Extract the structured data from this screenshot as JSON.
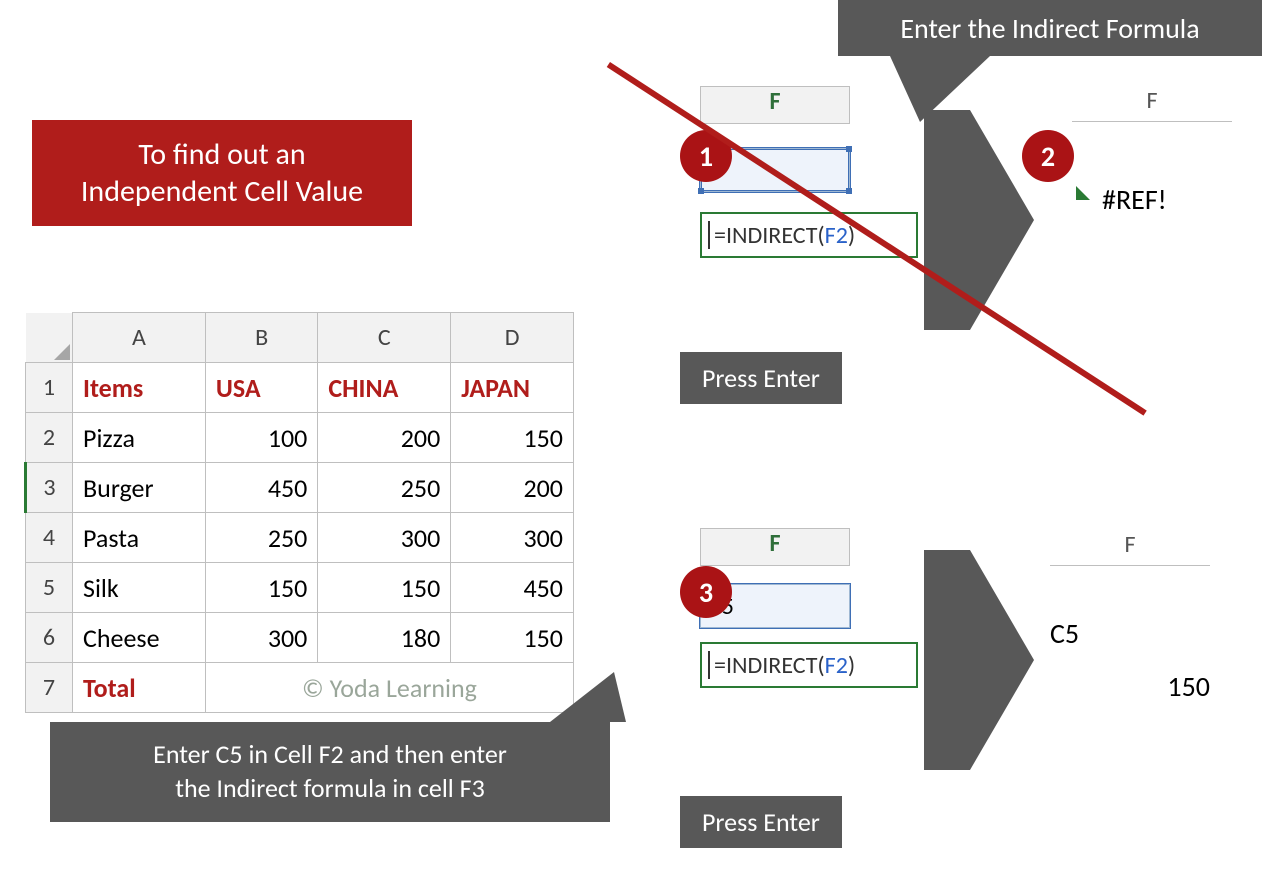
{
  "callouts": {
    "top": "Enter the Indirect Formula",
    "red_line1": "To find out an",
    "red_line2": "Independent Cell Value",
    "bottom_line1": "Enter C5 in Cell F2 and then enter",
    "bottom_line2": "the Indirect formula in cell F3",
    "press_enter": "Press Enter"
  },
  "badges": {
    "one": "1",
    "two": "2",
    "three": "3"
  },
  "sheet": {
    "colA": "A",
    "colB": "B",
    "colC": "C",
    "colD": "D",
    "r1": "1",
    "r2": "2",
    "r3": "3",
    "r4": "4",
    "r5": "5",
    "r6": "6",
    "r7": "7",
    "h_items": "Items",
    "h_usa": "USA",
    "h_china": "CHINA",
    "h_japan": "JAPAN",
    "rows": {
      "pizza": {
        "name": "Pizza",
        "usa": "100",
        "china": "200",
        "japan": "150"
      },
      "burger": {
        "name": "Burger",
        "usa": "450",
        "china": "250",
        "japan": "200"
      },
      "pasta": {
        "name": "Pasta",
        "usa": "250",
        "china": "300",
        "japan": "300"
      },
      "silk": {
        "name": "Silk",
        "usa": "150",
        "china": "150",
        "japan": "450"
      },
      "cheese": {
        "name": "Cheese",
        "usa": "300",
        "china": "180",
        "japan": "150"
      }
    },
    "total_label": "Total",
    "watermark": "© Yoda Learning"
  },
  "frag": {
    "col_letter": "F",
    "formula_eq": "=INDIRECT(",
    "formula_arg": "F2",
    "formula_close": ")",
    "c5_label": "C5",
    "ref_error": "#REF!",
    "result_value": "150"
  },
  "chart_data": {
    "type": "table",
    "title": "To find out an Independent Cell Value",
    "columns": [
      "Items",
      "USA",
      "CHINA",
      "JAPAN"
    ],
    "rows": [
      [
        "Pizza",
        100,
        200,
        150
      ],
      [
        "Burger",
        450,
        250,
        200
      ],
      [
        "Pasta",
        250,
        300,
        300
      ],
      [
        "Silk",
        150,
        150,
        450
      ],
      [
        "Cheese",
        300,
        180,
        150
      ]
    ],
    "annotations": [
      "Enter the Indirect Formula",
      "Press Enter",
      "Enter C5 in Cell F2 and then enter the Indirect formula in cell F3"
    ],
    "formula": "=INDIRECT(F2)",
    "example_input": "C5",
    "example_output": 150,
    "error_output": "#REF!"
  }
}
